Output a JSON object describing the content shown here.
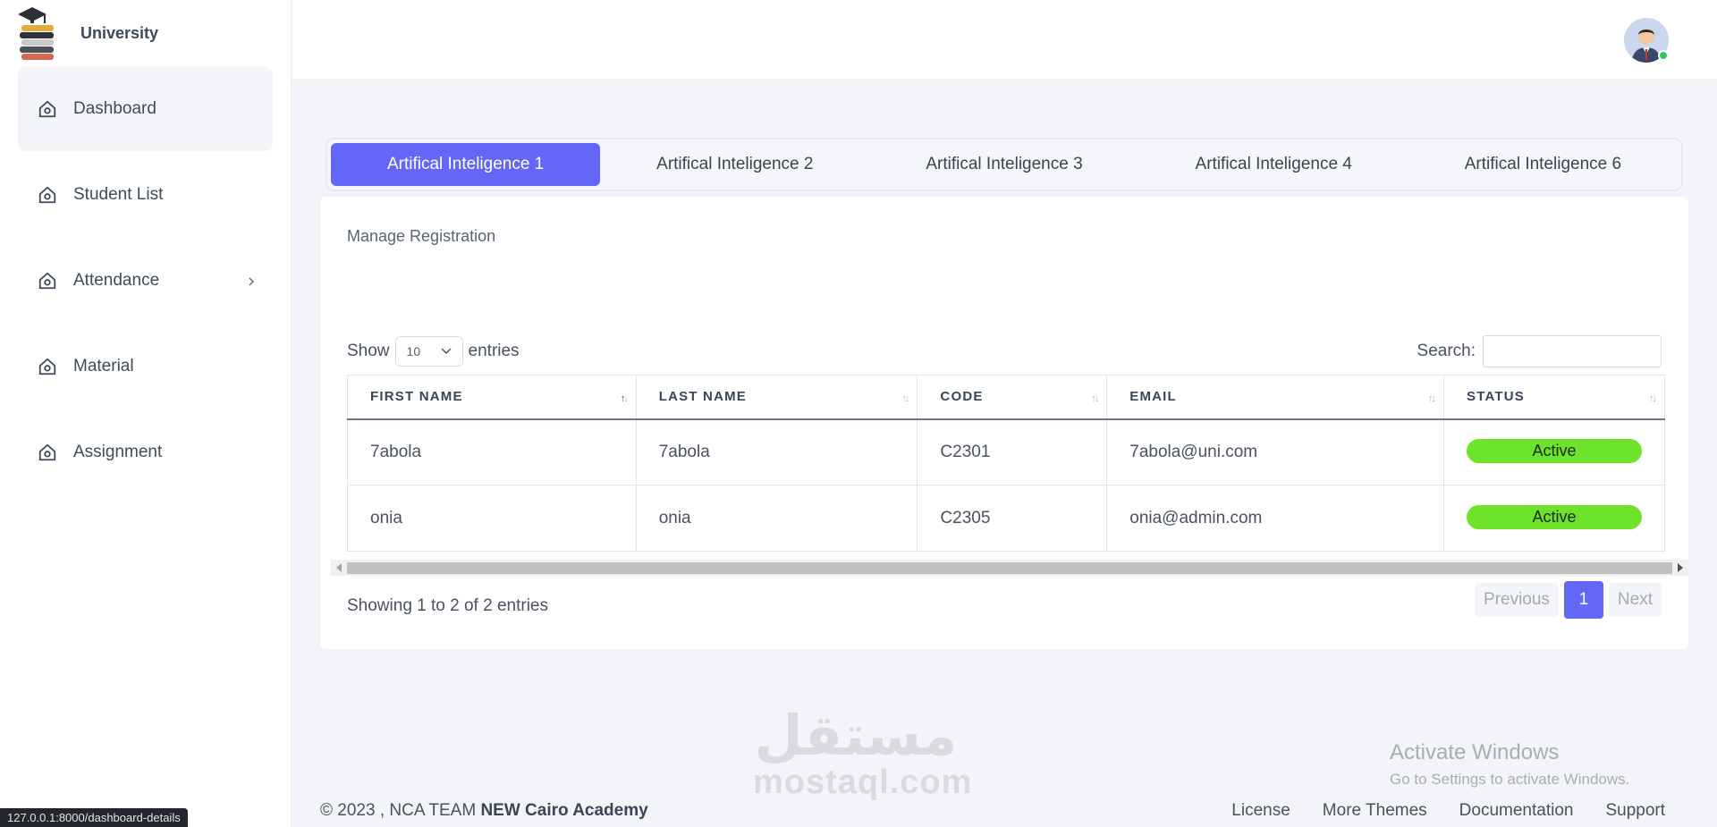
{
  "brand": {
    "name": "University",
    "logo_icon": "graduation-books-icon"
  },
  "sidebar": {
    "items": [
      {
        "label": "Dashboard",
        "icon": "home-icon",
        "active": true
      },
      {
        "label": "Student List",
        "icon": "home-icon"
      },
      {
        "label": "Attendance",
        "icon": "home-icon",
        "has_submenu": true
      },
      {
        "label": "Material",
        "icon": "home-icon"
      },
      {
        "label": "Assignment",
        "icon": "home-icon"
      }
    ]
  },
  "topbar": {
    "avatar_icon": "user-avatar",
    "status_color": "#34c55a"
  },
  "tabs": [
    {
      "label": "Artifical Inteligence 1",
      "active": true
    },
    {
      "label": "Artifical Inteligence 2"
    },
    {
      "label": "Artifical Inteligence 3"
    },
    {
      "label": "Artifical Inteligence 4"
    },
    {
      "label": "Artifical Inteligence 6"
    }
  ],
  "card": {
    "title": "Manage Registration",
    "show_label": "Show",
    "entries_label": "entries",
    "page_size": "10",
    "search_label": "Search:",
    "search_value": "",
    "columns": [
      "FIRST NAME",
      "LAST NAME",
      "CODE",
      "EMAIL",
      "STATUS"
    ],
    "rows": [
      {
        "first": "7abola",
        "last": "7abola",
        "code": "C2301",
        "email": "7abola@uni.com",
        "status": "Active"
      },
      {
        "first": "onia",
        "last": "onia",
        "code": "C2305",
        "email": "onia@admin.com",
        "status": "Active"
      }
    ],
    "info": "Showing 1 to 2 of 2 entries",
    "pager": {
      "previous": "Previous",
      "page": "1",
      "next": "Next"
    }
  },
  "footer": {
    "copyright": "© 2023 , NCA TEAM",
    "org": "NEW Cairo Academy",
    "links": [
      "License",
      "More Themes",
      "Documentation",
      "Support"
    ]
  },
  "watermark": {
    "arabic": "مستقل",
    "latin": "mostaql.com"
  },
  "windows_notice": {
    "title": "Activate Windows",
    "subtitle": "Go to Settings to activate Windows."
  },
  "statusbar": {
    "url": "127.0.0.1:8000/dashboard-details"
  },
  "colors": {
    "accent": "#6366f6",
    "active_badge": "#6ee32b"
  }
}
